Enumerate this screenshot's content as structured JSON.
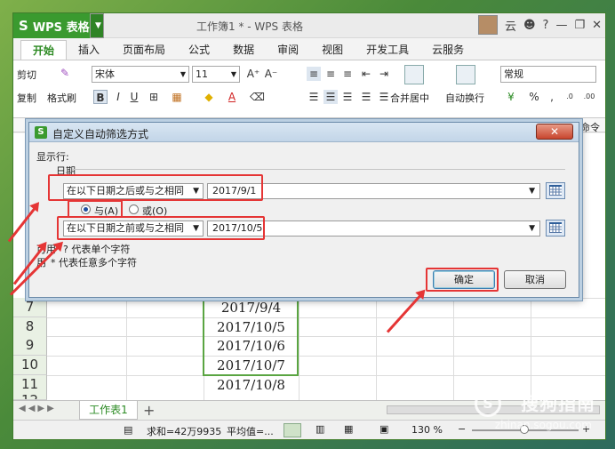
{
  "app": {
    "logo": "WPS 表格",
    "doc_title": "工作簿1 * - WPS 表格",
    "user": "云"
  },
  "tabs": [
    "开始",
    "插入",
    "页面布局",
    "公式",
    "数据",
    "审阅",
    "视图",
    "开发工具",
    "云服务"
  ],
  "ribbon": {
    "cut": "剪切",
    "copy": "复制",
    "format_painter": "格式刷",
    "font_name": "宋体",
    "font_size": "11",
    "merge_center": "合并居中",
    "wrap_text": "自动换行",
    "number_format": "常规"
  },
  "extra_right": "命令",
  "sheet": {
    "rows": [
      {
        "num": "7",
        "value": "2017/9/4"
      },
      {
        "num": "8",
        "value": "2017/10/5"
      },
      {
        "num": "9",
        "value": "2017/10/6"
      },
      {
        "num": "10",
        "value": "2017/10/7"
      },
      {
        "num": "11",
        "value": "2017/10/8"
      },
      {
        "num": "12",
        "value": ""
      }
    ],
    "sheet_tab": "工作表1",
    "add_sheet": "+"
  },
  "status": {
    "sum": "求和=42万9935",
    "avg": "平均值=...",
    "zoom": "130 %"
  },
  "dialog": {
    "title": "自定义自动筛选方式",
    "close": "✕",
    "show_rows": "显示行:",
    "field": "日期",
    "cond1_op": "在以下日期之后或与之相同",
    "cond1_val": "2017/9/1",
    "and_label": "与(A)",
    "or_label": "或(O)",
    "cond2_op": "在以下日期之前或与之相同",
    "cond2_val": "2017/10/5",
    "hint1_prefix": "可用",
    "hint1": "? 代表单个字符",
    "hint2_prefix": "用",
    "hint2": "* 代表任意多个字符",
    "ok": "确定",
    "cancel": "取消"
  },
  "watermark": {
    "brand": "搜狗指南",
    "url": "zhinan.sogou.com"
  },
  "colors": {
    "wps_green": "#3a9a2f",
    "highlight_red": "#e53535"
  }
}
